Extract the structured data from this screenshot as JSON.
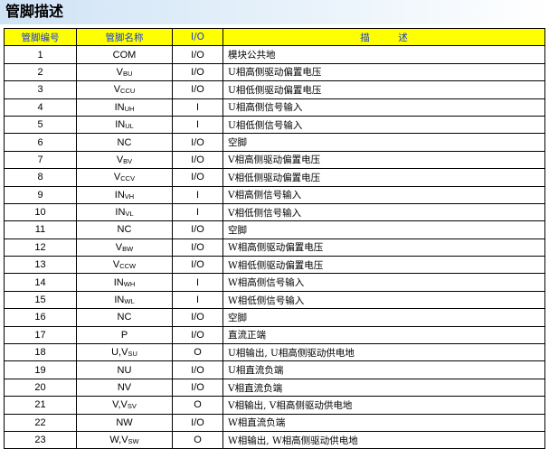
{
  "title": "管脚描述",
  "headers": [
    "管脚编号",
    "管脚名称",
    "I/O",
    "描　　　述"
  ],
  "rows": [
    {
      "num": "1",
      "name": "COM",
      "sub": "",
      "io": "I/O",
      "desc": "模块公共地"
    },
    {
      "num": "2",
      "name": "V",
      "sub": "BU",
      "io": "I/O",
      "desc": "U相高侧驱动偏置电压"
    },
    {
      "num": "3",
      "name": "V",
      "sub": "CCU",
      "io": "I/O",
      "desc": "U相低侧驱动偏置电压"
    },
    {
      "num": "4",
      "name": "IN",
      "sub": "UH",
      "io": "I",
      "desc": "U相高侧信号输入"
    },
    {
      "num": "5",
      "name": "IN",
      "sub": "UL",
      "io": "I",
      "desc": "U相低侧信号输入"
    },
    {
      "num": "6",
      "name": "NC",
      "sub": "",
      "io": "I/O",
      "desc": "空脚"
    },
    {
      "num": "7",
      "name": "V",
      "sub": "BV",
      "io": "I/O",
      "desc": "V相高侧驱动偏置电压"
    },
    {
      "num": "8",
      "name": "V",
      "sub": "CCV",
      "io": "I/O",
      "desc": "V相低侧驱动偏置电压"
    },
    {
      "num": "9",
      "name": "IN",
      "sub": "VH",
      "io": "I",
      "desc": "V相高侧信号输入"
    },
    {
      "num": "10",
      "name": "IN",
      "sub": "VL",
      "io": "I",
      "desc": "V相低侧信号输入"
    },
    {
      "num": "11",
      "name": "NC",
      "sub": "",
      "io": "I/O",
      "desc": "空脚"
    },
    {
      "num": "12",
      "name": "V",
      "sub": "BW",
      "io": "I/O",
      "desc": "W相高侧驱动偏置电压"
    },
    {
      "num": "13",
      "name": "V",
      "sub": "CCW",
      "io": "I/O",
      "desc": "W相低侧驱动偏置电压"
    },
    {
      "num": "14",
      "name": "IN",
      "sub": "WH",
      "io": "I",
      "desc": "W相高侧信号输入"
    },
    {
      "num": "15",
      "name": "IN",
      "sub": "WL",
      "io": "I",
      "desc": "W相低侧信号输入"
    },
    {
      "num": "16",
      "name": "NC",
      "sub": "",
      "io": "I/O",
      "desc": "空脚"
    },
    {
      "num": "17",
      "name": "P",
      "sub": "",
      "io": "I/O",
      "desc": "直流正端"
    },
    {
      "num": "18",
      "name": "U,V",
      "sub": "SU",
      "io": "O",
      "desc": "U相输出, U相高侧驱动供电地"
    },
    {
      "num": "19",
      "name": "NU",
      "sub": "",
      "io": "I/O",
      "desc": "U相直流负端"
    },
    {
      "num": "20",
      "name": "NV",
      "sub": "",
      "io": "I/O",
      "desc": "V相直流负端"
    },
    {
      "num": "21",
      "name": "V,V",
      "sub": "SV",
      "io": "O",
      "desc": "V相输出, V相高侧驱动供电地"
    },
    {
      "num": "22",
      "name": "NW",
      "sub": "",
      "io": "I/O",
      "desc": "W相直流负端"
    },
    {
      "num": "23",
      "name": "W,V",
      "sub": "SW",
      "io": "O",
      "desc": "W相输出, W相高侧驱动供电地"
    }
  ]
}
